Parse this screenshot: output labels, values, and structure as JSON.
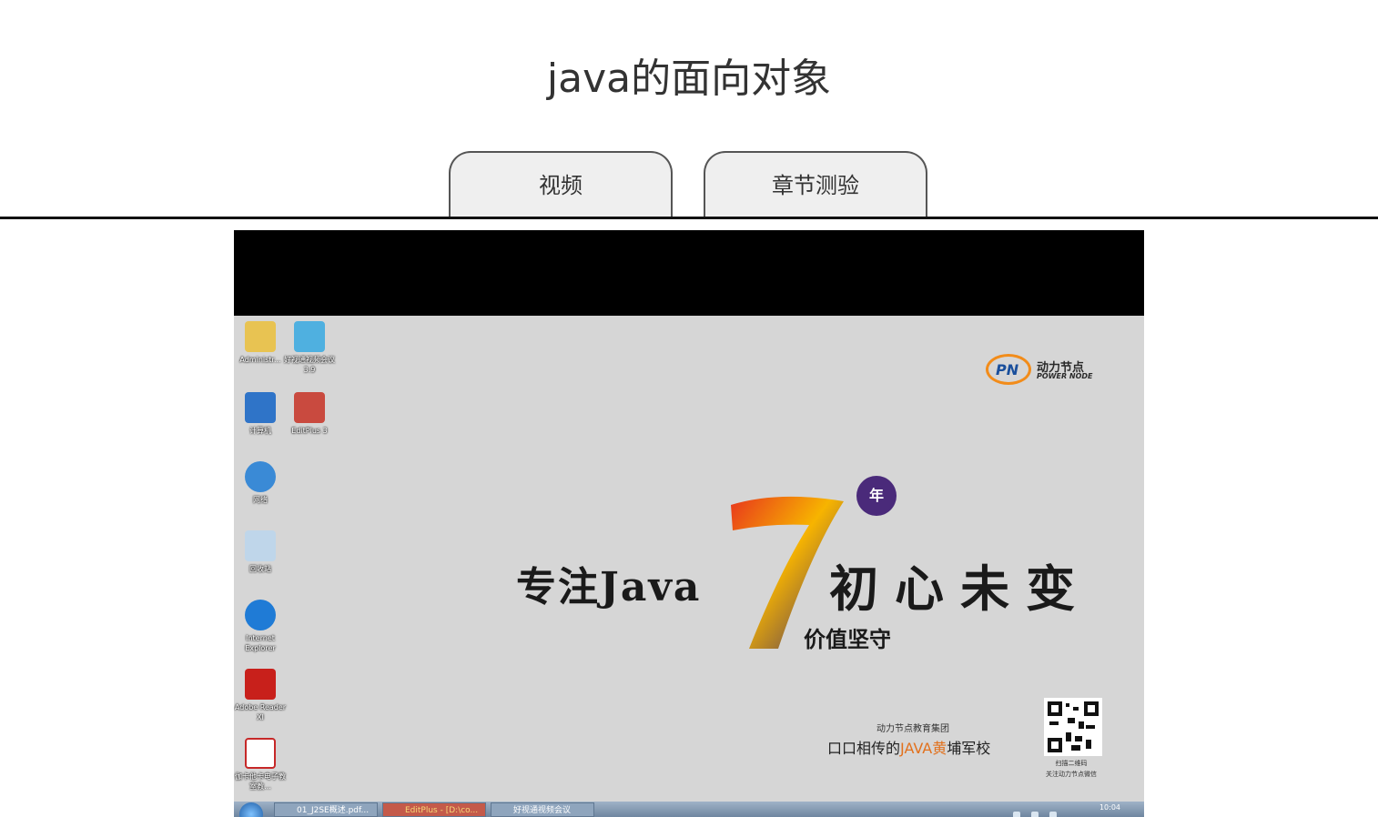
{
  "page": {
    "title": "java的面向对象"
  },
  "tabs": [
    {
      "label": "视频"
    },
    {
      "label": "章节测验"
    }
  ],
  "desktop": {
    "icons": [
      {
        "label": "Administr...",
        "icon": "user-folder-icon",
        "color": "#e8c352"
      },
      {
        "label": "好视通视频会议3.9",
        "icon": "video-meeting-icon",
        "color": "#4fb0e0"
      },
      {
        "label": "计算机",
        "icon": "computer-icon",
        "color": "#2f74c8"
      },
      {
        "label": "EditPlus 3",
        "icon": "editplus-icon",
        "color": "#c94a3f"
      },
      {
        "label": "网络",
        "icon": "network-icon",
        "color": "#3a8ad6"
      },
      {
        "label": "回收站",
        "icon": "recycle-bin-icon",
        "color": "#bfd6ea"
      },
      {
        "label": "Internet Explorer",
        "icon": "ie-icon",
        "color": "#1f7bd6"
      },
      {
        "label": "Adobe Reader XI",
        "icon": "adobe-reader-icon",
        "color": "#c8201b"
      },
      {
        "label": "伽卡他卡电子教室教...",
        "icon": "classroom-icon",
        "color": "#c62828"
      }
    ],
    "logo": {
      "mark": "PN",
      "cn": "动力节点",
      "en": "POWER NODE"
    },
    "slogan_left": "专注Java",
    "slogan_right": "初心未变",
    "badge": "年",
    "value_text": "价值坚守",
    "group": "动力节点教育集团",
    "motto_pre": "口口相传的",
    "motto_hl": "JAVA黄",
    "motto_post": "埔军校",
    "qr_caption": [
      "扫描二维码",
      "关注动力节点微信"
    ]
  },
  "taskbar": {
    "items": [
      {
        "label": "01_J2SE概述.pdf...",
        "icon": "pdf-icon",
        "active": false
      },
      {
        "label": "EditPlus - [D:\\co...",
        "icon": "editplus-icon",
        "active": true
      },
      {
        "label": "好视通视频会议",
        "icon": "video-meeting-icon",
        "active": false
      }
    ],
    "clock": "10:04"
  }
}
